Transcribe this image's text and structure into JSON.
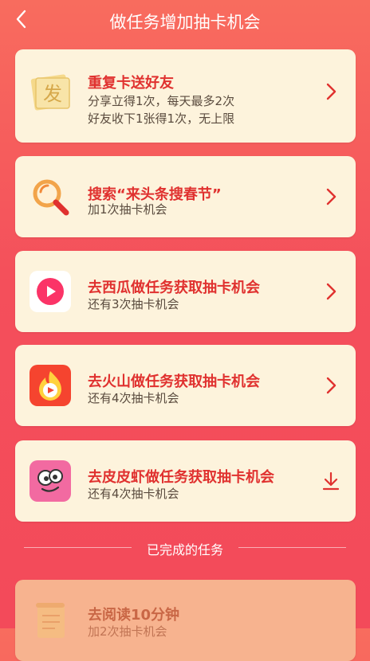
{
  "header": {
    "title": "做任务增加抽卡机会",
    "back_icon": "chevron-left-icon"
  },
  "tasks": [
    {
      "title": "重复卡送好友",
      "line1": "分享立得1次，每天最多2次",
      "line2": "好友收下1张得1次，无上限",
      "icon": "fa-card-icon",
      "action_icon": "chevron-right-icon"
    },
    {
      "title": "搜索“来头条搜春节”",
      "line1": "加1次抽卡机会",
      "icon": "search-icon",
      "action_icon": "chevron-right-icon"
    },
    {
      "title": "去西瓜做任务获取抽卡机会",
      "line1": "还有3次抽卡机会",
      "icon": "xigua-app-icon",
      "action_icon": "chevron-right-icon"
    },
    {
      "title": "去火山做任务获取抽卡机会",
      "line1": "还有4次抽卡机会",
      "icon": "huoshan-app-icon",
      "action_icon": "chevron-right-icon"
    },
    {
      "title": "去皮皮虾做任务获取抽卡机会",
      "line1": "还有4次抽卡机会",
      "icon": "pipixia-app-icon",
      "action_icon": "download-icon"
    }
  ],
  "completed": {
    "label": "已完成的任务",
    "tasks": [
      {
        "title": "去阅读10分钟",
        "line1": "加2次抽卡机会",
        "icon": "scroll-icon"
      }
    ]
  },
  "colors": {
    "background": "#f44f5b",
    "card": "#fdf3dc",
    "title_red": "#e0312f"
  }
}
